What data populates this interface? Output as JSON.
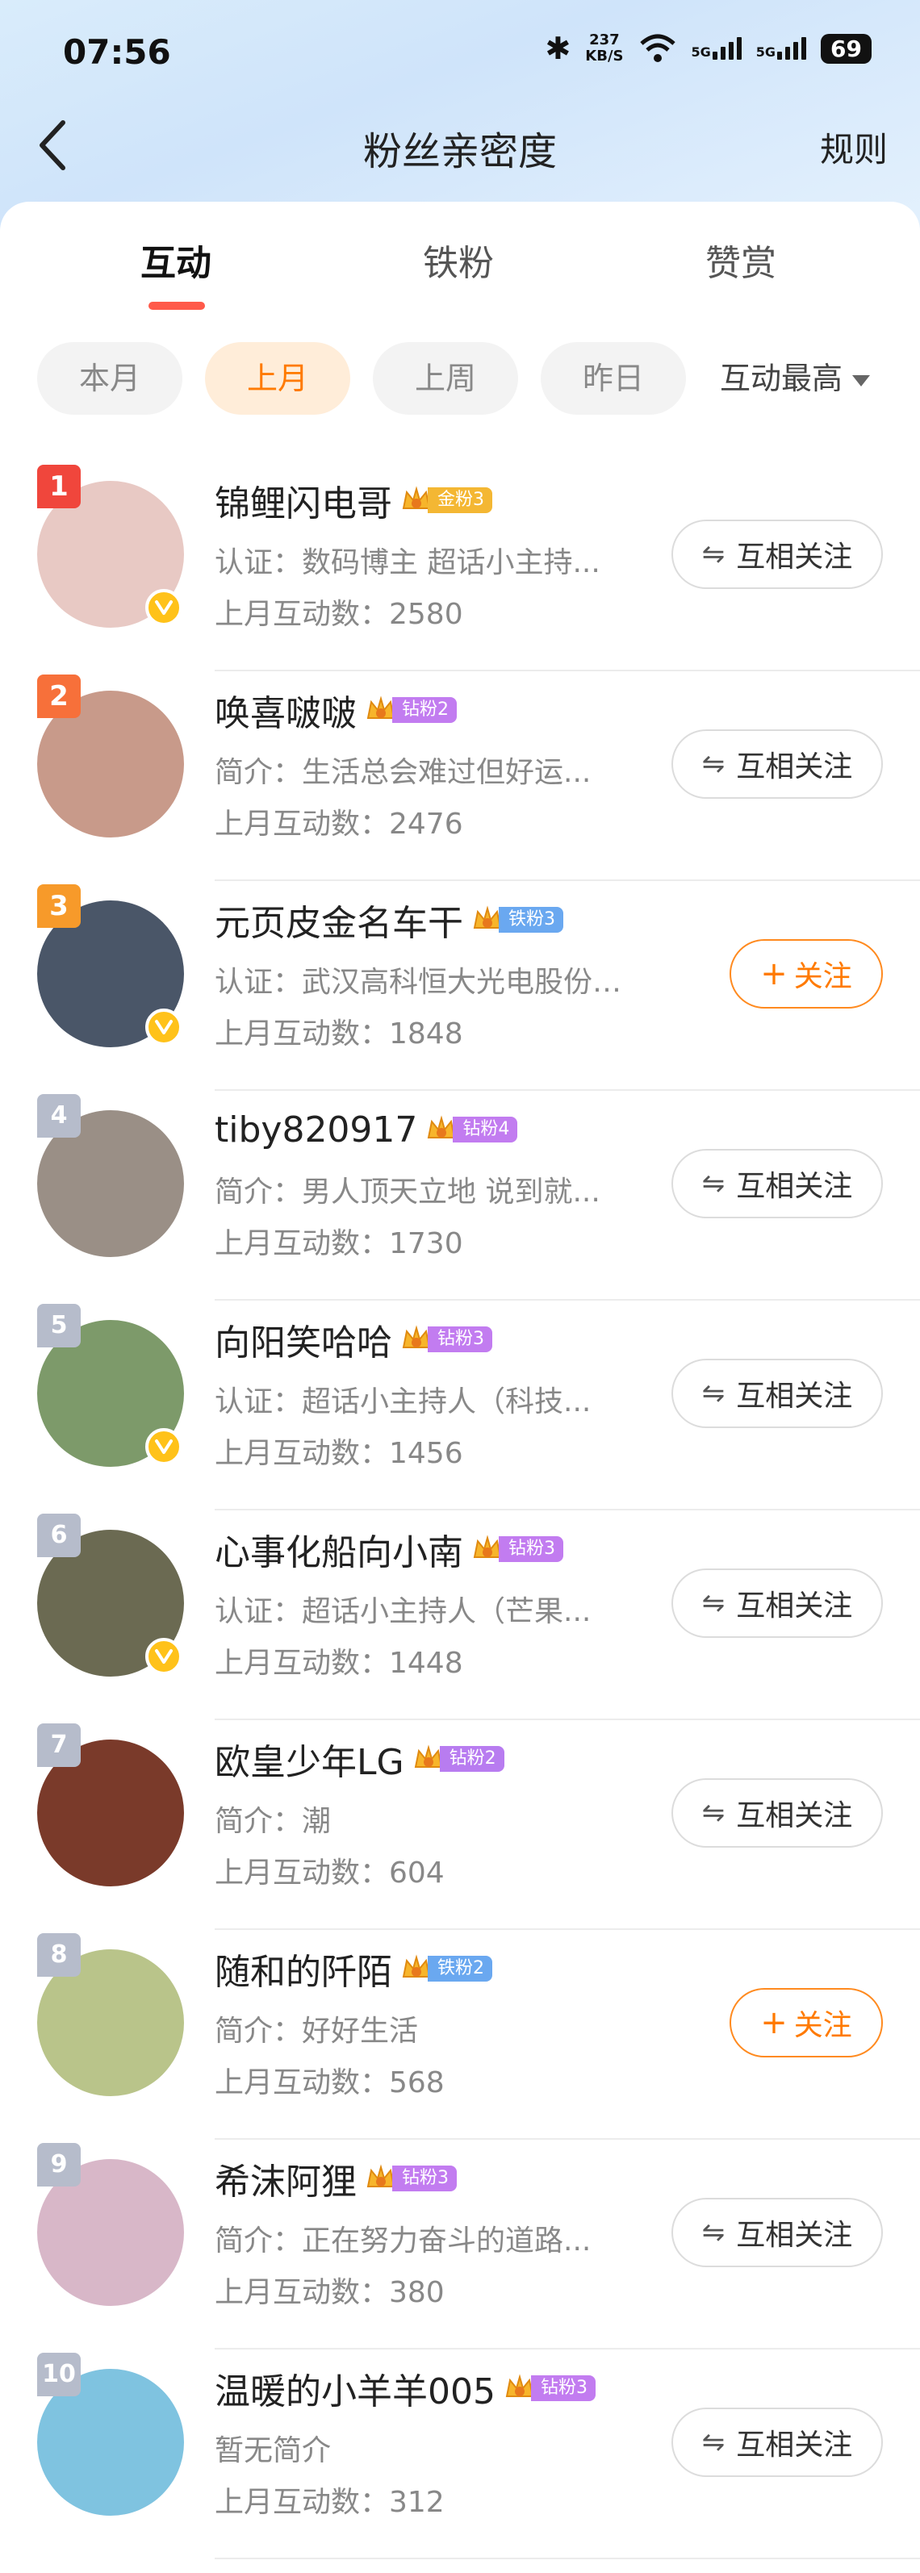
{
  "status_bar": {
    "time": "07:56",
    "speed_value": "237",
    "speed_unit": "KB/S",
    "sig1": "5G",
    "sig2": "5G",
    "battery": "69"
  },
  "nav": {
    "back_icon": "chevron-left-icon",
    "title": "粉丝亲密度",
    "rule_label": "规则"
  },
  "tabs": [
    {
      "label": "互动",
      "active": true
    },
    {
      "label": "铁粉",
      "active": false
    },
    {
      "label": "赞赏",
      "active": false
    }
  ],
  "filters": {
    "chips": [
      {
        "label": "本月",
        "active": false
      },
      {
        "label": "上月",
        "active": true
      },
      {
        "label": "上周",
        "active": false
      },
      {
        "label": "昨日",
        "active": false
      }
    ],
    "sort_label": "互动最高"
  },
  "fans": [
    {
      "rank": "1",
      "name": "锦鲤闪电哥",
      "badge": "金粉3",
      "badge_color": "#f4b733",
      "desc": "认证：数码博主 超话小主持...",
      "count": "上月互动数：2580",
      "verified": true,
      "button": "互相关注",
      "mutual": true,
      "avatar_bg": "#e8c9c4"
    },
    {
      "rank": "2",
      "name": "唤喜啵啵",
      "badge": "钻粉2",
      "badge_color": "#c27cf0",
      "desc": "简介：生活总会难过但好运...",
      "count": "上月互动数：2476",
      "verified": false,
      "button": "互相关注",
      "mutual": true,
      "avatar_bg": "#c89a8a"
    },
    {
      "rank": "3",
      "name": "元页皮金名车干",
      "badge": "铁粉3",
      "badge_color": "#6aa8f0",
      "desc": "认证：武汉高科恒大光电股份有...",
      "count": "上月互动数：1848",
      "verified": true,
      "button": "关注",
      "mutual": false,
      "avatar_bg": "#4a5668"
    },
    {
      "rank": "4",
      "name": "tiby820917",
      "badge": "钻粉4",
      "badge_color": "#c27cf0",
      "desc": "简介：男人顶天立地 说到就...",
      "count": "上月互动数：1730",
      "verified": false,
      "button": "互相关注",
      "mutual": true,
      "avatar_bg": "#9a8f86"
    },
    {
      "rank": "5",
      "name": "向阳笑哈哈",
      "badge": "钻粉3",
      "badge_color": "#c27cf0",
      "desc": "认证：超话小主持人（科技...",
      "count": "上月互动数：1456",
      "verified": true,
      "button": "互相关注",
      "mutual": true,
      "avatar_bg": "#7d9a6a"
    },
    {
      "rank": "6",
      "name": "心事化船向小南",
      "badge": "钻粉3",
      "badge_color": "#c27cf0",
      "desc": "认证：超话小主持人（芒果...",
      "count": "上月互动数：1448",
      "verified": true,
      "button": "互相关注",
      "mutual": true,
      "avatar_bg": "#6b6a52"
    },
    {
      "rank": "7",
      "name": "欧皇少年LG",
      "badge": "钻粉2",
      "badge_color": "#b87cf0",
      "desc": "简介：潮",
      "count": "上月互动数：604",
      "verified": false,
      "button": "互相关注",
      "mutual": true,
      "avatar_bg": "#7a3a2a"
    },
    {
      "rank": "8",
      "name": "随和的阡陌",
      "badge": "铁粉2",
      "badge_color": "#6aa8f0",
      "desc": "简介：好好生活",
      "count": "上月互动数：568",
      "verified": false,
      "button": "关注",
      "mutual": false,
      "avatar_bg": "#b9c48a"
    },
    {
      "rank": "9",
      "name": "希沫阿狸",
      "badge": "钻粉3",
      "badge_color": "#c27cf0",
      "desc": "简介：正在努力奋斗的道路...",
      "count": "上月互动数：380",
      "verified": false,
      "button": "互相关注",
      "mutual": true,
      "avatar_bg": "#d8b7c8"
    },
    {
      "rank": "10",
      "name": "温暖的小羊羊005",
      "badge": "钻粉3",
      "badge_color": "#c27cf0",
      "desc": "暂无简介",
      "count": "上月互动数：312",
      "verified": false,
      "button": "互相关注",
      "mutual": true,
      "avatar_bg": "#7fc3e0"
    }
  ],
  "colors": {
    "accent": "#ff5a4a",
    "orange": "#ff7a00",
    "rank1": "#f0463c",
    "rank2": "#f7703a",
    "rank3": "#f79a2a",
    "rank_other": "#b6bccb"
  }
}
